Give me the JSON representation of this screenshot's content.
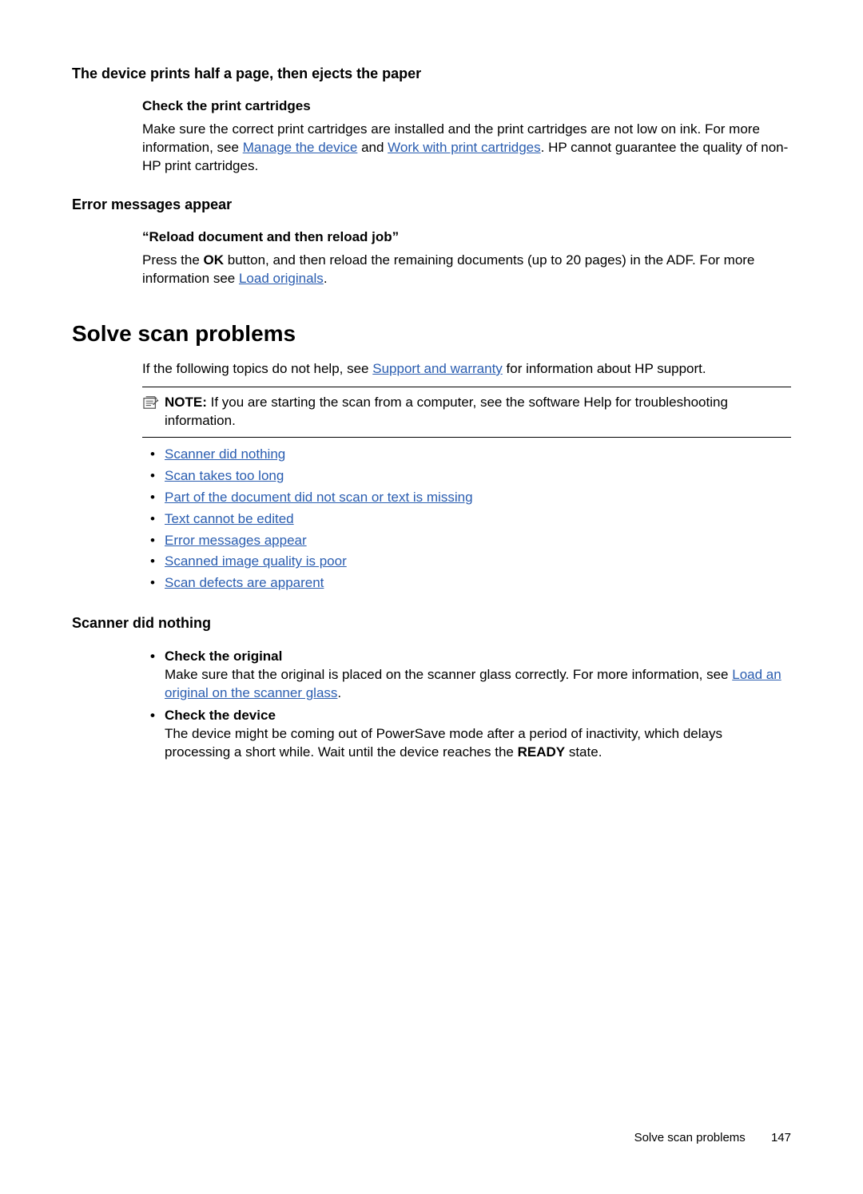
{
  "section1": {
    "heading": "The device prints half a page, then ejects the paper",
    "sub_heading": "Check the print cartridges",
    "p1a": "Make sure the correct print cartridges are installed and the print cartridges are not low on ink. For more information, see ",
    "link1": "Manage the device",
    "p1b": " and ",
    "link2": "Work with print cartridges",
    "p1c": ". HP cannot guarantee the quality of non-HP print cartridges."
  },
  "section2": {
    "heading": "Error messages appear",
    "sub_heading": "“Reload document and then reload job”",
    "p_a": "Press the ",
    "ok": "OK",
    "p_b": " button, and then reload the remaining documents (up to 20 pages) in the ADF. For more information see ",
    "link": "Load originals",
    "p_c": "."
  },
  "section3": {
    "heading": "Solve scan problems",
    "intro_a": "If the following topics do not help, see ",
    "intro_link": "Support and warranty",
    "intro_b": " for information about HP support.",
    "note_label": "NOTE:",
    "note_text": "If you are starting the scan from a computer, see the software Help for troubleshooting information.",
    "links": [
      "Scanner did nothing",
      "Scan takes too long",
      "Part of the document did not scan or text is missing",
      "Text cannot be edited",
      "Error messages appear",
      "Scanned image quality is poor",
      "Scan defects are apparent"
    ]
  },
  "section4": {
    "heading": "Scanner did nothing",
    "item1_title": "Check the original",
    "item1_text_a": "Make sure that the original is placed on the scanner glass correctly. For more information, see ",
    "item1_link": "Load an original on the scanner glass",
    "item1_text_b": ".",
    "item2_title": "Check the device",
    "item2_text_a": "The device might be coming out of PowerSave mode after a period of inactivity, which delays processing a short while. Wait until the device reaches the ",
    "item2_bold": "READY",
    "item2_text_b": " state."
  },
  "footer": {
    "title": "Solve scan problems",
    "page": "147"
  }
}
